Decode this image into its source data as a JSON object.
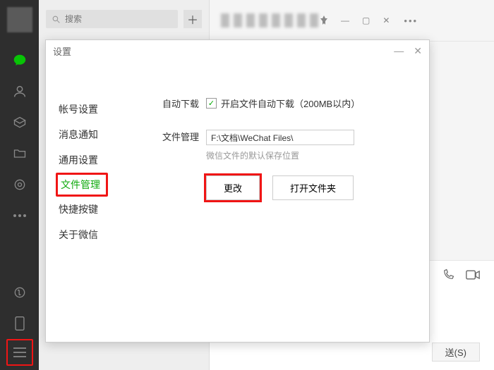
{
  "search": {
    "placeholder": "搜索"
  },
  "rail": {
    "icons": [
      "chat-icon",
      "contacts-icon",
      "favorites-icon",
      "files-icon",
      "moments-icon",
      "more-dots-icon",
      "miniprogram-icon",
      "phone-icon",
      "menu-icon"
    ]
  },
  "window_controls": {
    "pin": "⊼",
    "min": "—",
    "max": "▢",
    "close": "✕"
  },
  "chat_footer": {
    "send": "送(S)"
  },
  "settings": {
    "title": "设置",
    "nav": {
      "account": "帐号设置",
      "notify": "消息通知",
      "general": "通用设置",
      "files": "文件管理",
      "shortcut": "快捷按键",
      "about": "关于微信"
    },
    "content": {
      "auto_download_label": "自动下载",
      "auto_download_checkbox": "开启文件自动下载（200MB以内）",
      "file_mgmt_label": "文件管理",
      "path_value": "F:\\文档\\WeChat Files\\",
      "path_hint": "微信文件的默认保存位置",
      "change_btn": "更改",
      "open_folder_btn": "打开文件夹"
    }
  }
}
